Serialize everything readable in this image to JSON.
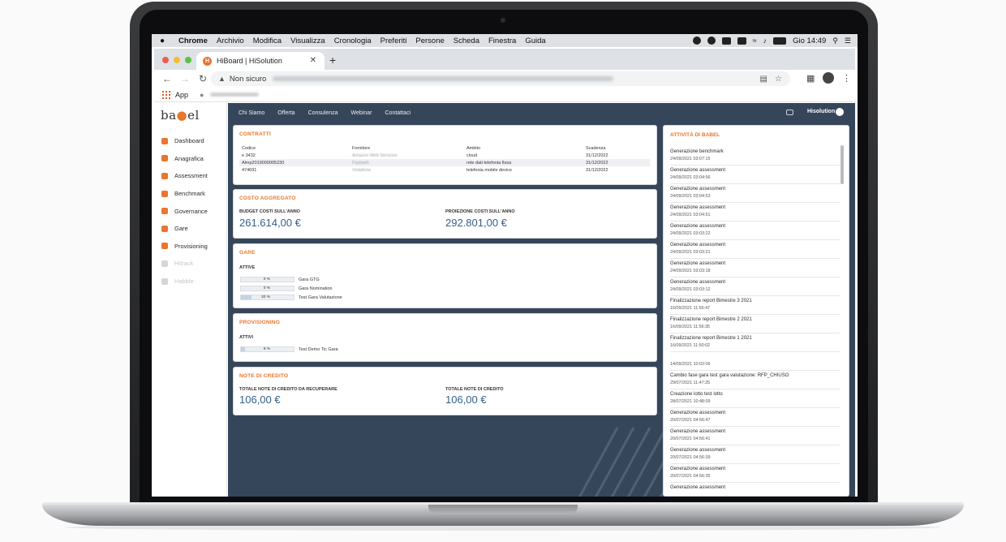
{
  "menubar": {
    "items": [
      "Chrome",
      "Archivio",
      "Modifica",
      "Visualizza",
      "Cronologia",
      "Preferiti",
      "Persone",
      "Scheda",
      "Finestra",
      "Guida"
    ],
    "clock": "Gio 14:49"
  },
  "browser": {
    "tab_title": "HiBoard | HiSolution",
    "security_label": "Non sicuro",
    "bookmarks_app": "App"
  },
  "sidebar": {
    "logo": {
      "a": "ba",
      "dot": "●",
      "b": "el"
    },
    "items": [
      {
        "label": "Dashboard",
        "icon": "dashboard-icon",
        "enabled": true
      },
      {
        "label": "Anagrafica",
        "icon": "people-icon",
        "enabled": true
      },
      {
        "label": "Assessment",
        "icon": "trend-icon",
        "enabled": true
      },
      {
        "label": "Benchmark",
        "icon": "gauge-icon",
        "enabled": true
      },
      {
        "label": "Governance",
        "icon": "document-icon",
        "enabled": true
      },
      {
        "label": "Gare",
        "icon": "trophy-icon",
        "enabled": true
      },
      {
        "label": "Provisioning",
        "icon": "sync-icon",
        "enabled": true
      },
      {
        "label": "Hitrack",
        "icon": "chart-icon",
        "enabled": false
      },
      {
        "label": "Habble",
        "icon": "grid-icon",
        "enabled": false
      }
    ]
  },
  "topnav": {
    "links": [
      "Chi Siamo",
      "Offerta",
      "Consulenza",
      "Webinar",
      "Contattaci"
    ],
    "user": "Hisolution"
  },
  "contratti": {
    "title": "CONTRATTI",
    "columns": [
      "Codice",
      "Fornitore",
      "Ambito",
      "Scadenza"
    ],
    "rows": [
      [
        "e 3432",
        "Amazon Web Services",
        "cloud",
        "31/12/2022"
      ],
      [
        "Almp2019000005230",
        "Fastweb",
        "rete dati telefonia fissa",
        "31/12/2022"
      ],
      [
        "474691",
        "Vodafone",
        "telefonia mobile device",
        "31/12/2022"
      ]
    ]
  },
  "costo": {
    "title": "COSTO AGGREGATO",
    "budget_label": "BUDGET COSTI SULL'ANNO",
    "budget_value": "261.614,00 €",
    "proiezione_label": "PROIEZIONE COSTI SULL'ANNO",
    "proiezione_value": "292.801,00 €"
  },
  "gare": {
    "title": "GARE",
    "subtitle": "ATTIVE",
    "items": [
      {
        "pct_label": "0 %",
        "progress": 0,
        "label": "Gara GTG"
      },
      {
        "pct_label": "0 %",
        "progress": 0,
        "label": "Gara Nomination"
      },
      {
        "pct_label": "20 %",
        "progress": 20,
        "label": "Test Gara Valutazione"
      }
    ]
  },
  "provisioning": {
    "title": "PROVISIONING",
    "subtitle": "ATTIVI",
    "items": [
      {
        "pct_label": "8 %",
        "progress": 8,
        "label": "Test Demo Tic Gara"
      }
    ]
  },
  "note": {
    "title": "NOTE DI CREDITO",
    "recuperare_label": "TOTALE NOTE DI CREDITO DA RECUPERARE",
    "recuperare_value": "106,00 €",
    "totale_label": "TOTALE NOTE DI CREDITO",
    "totale_value": "106,00 €"
  },
  "activity": {
    "title": "ATTIVITÀ DI BABEL",
    "items": [
      {
        "text": "Generazione benchmark",
        "date": "24/09/2021 03:07:15"
      },
      {
        "text": "Generazione assessment",
        "date": "24/09/2021 03:04:56"
      },
      {
        "text": "Generazione assessment",
        "date": "24/09/2021 03:04:53"
      },
      {
        "text": "Generazione assessment",
        "date": "24/09/2021 03:04:51"
      },
      {
        "text": "Generazione assessment",
        "date": "24/09/2021 03:03:22"
      },
      {
        "text": "Generazione assessment",
        "date": "24/09/2021 03:03:21"
      },
      {
        "text": "Generazione assessment",
        "date": "24/09/2021 03:03:18"
      },
      {
        "text": "Generazione assessment",
        "date": "24/09/2021 03:03:12"
      },
      {
        "text": "Finalizzazione report Bimestre 3 2021",
        "date": "16/09/2021 11:56:47"
      },
      {
        "text": "Finalizzazione report Bimestre 2 2021",
        "date": "16/09/2021 11:56:35"
      },
      {
        "text": "Finalizzazione report Bimestre 1 2021",
        "date": "16/09/2021 11:50:02"
      },
      {
        "text": "",
        "date": "14/09/2021 10:02:06"
      },
      {
        "text": "Cambio fase gara test gara valutazione: RFP_CHIUSO",
        "date": "29/07/2021 11:47:25"
      },
      {
        "text": "Creazione lotto test lotto",
        "date": "28/07/2021 10:48:09"
      },
      {
        "text": "Generazione assessment",
        "date": "20/07/2021 04:56:47"
      },
      {
        "text": "Generazione assessment",
        "date": "20/07/2021 04:56:41"
      },
      {
        "text": "Generazione assessment",
        "date": "20/07/2021 04:56:39"
      },
      {
        "text": "Generazione assessment",
        "date": "20/07/2021 04:56:35"
      },
      {
        "text": "Generazione assessment",
        "date": ""
      }
    ]
  },
  "colors": {
    "accent": "#e8762c",
    "page_bg": "#36465a",
    "kpi_value": "#34618a"
  }
}
